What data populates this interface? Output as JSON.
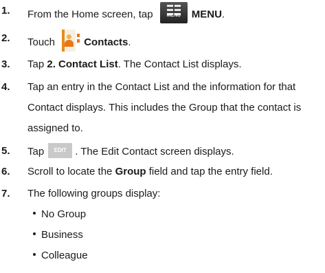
{
  "steps": [
    {
      "num": "1.",
      "pre": "From the Home screen, tap",
      "bold": "MENU",
      "post": "."
    },
    {
      "num": "2.",
      "pre": "Touch",
      "bold": "Contacts",
      "post": "."
    },
    {
      "num": "3.",
      "pre": "Tap ",
      "bold": "2. Contact List",
      "post": ". The Contact List displays."
    },
    {
      "num": "4.",
      "text": "Tap an entry in the Contact List and the information for that Contact displays. This includes the Group that the contact is assigned to."
    },
    {
      "num": "5.",
      "pre": "Tap",
      "post": ". The Edit Contact screen displays."
    },
    {
      "num": "6.",
      "pre": "Scroll to locate the ",
      "bold": "Group",
      "post": " field and tap the entry field."
    },
    {
      "num": "7.",
      "text": "The following groups display:"
    }
  ],
  "icons": {
    "menu_label": "MENU",
    "edit_label": "EDIT"
  },
  "groups": [
    "No Group",
    "Business",
    "Colleague"
  ]
}
